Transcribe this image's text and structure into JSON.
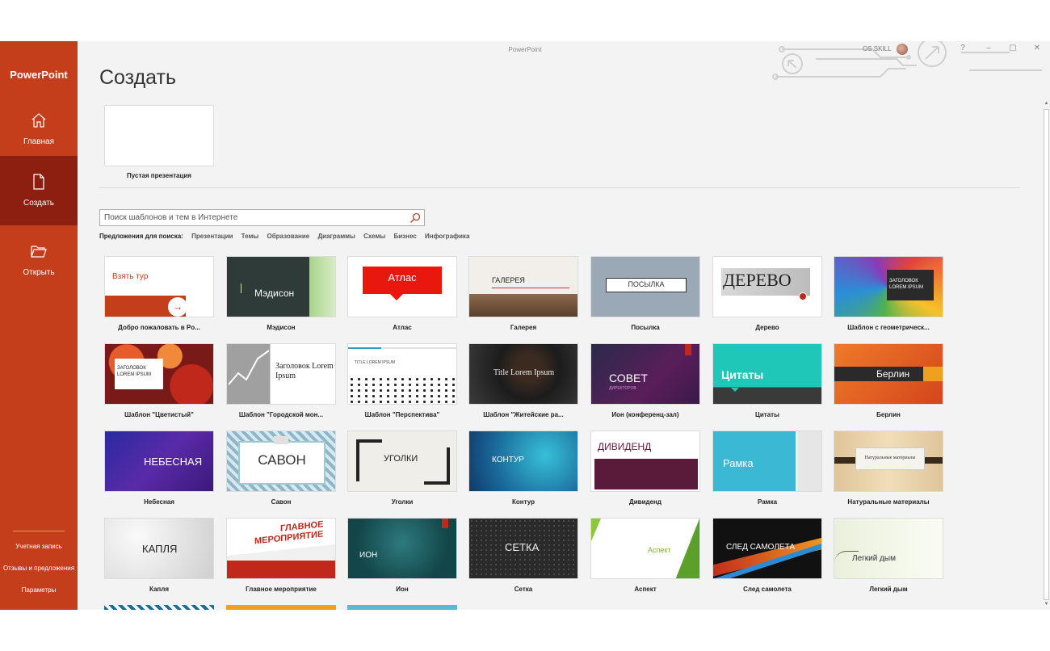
{
  "window": {
    "title": "PowerPoint",
    "user_name": "OS SKILL",
    "controls": [
      "?",
      "–",
      "▢",
      "✕"
    ]
  },
  "sidebar": {
    "app_name": "PowerPoint",
    "nav": [
      {
        "label": "Главная",
        "icon": "home-icon"
      },
      {
        "label": "Создать",
        "icon": "new-file-icon"
      },
      {
        "label": "Открыть",
        "icon": "folder-open-icon"
      }
    ],
    "bottom": [
      "Учетная запись",
      "Отзывы и предложения",
      "Параметры"
    ]
  },
  "main": {
    "title": "Создать",
    "blank_label": "Пустая презентация",
    "search": {
      "placeholder": "Поиск шаблонов и тем в Интернете"
    },
    "suggestions_label": "Предложения для поиска:",
    "suggestions": [
      "Презентации",
      "Темы",
      "Образование",
      "Диаграммы",
      "Схемы",
      "Бизнес",
      "Инфографика"
    ],
    "templates": [
      {
        "name": "Добро пожаловать в Po...",
        "thumb_text": "Взять тур"
      },
      {
        "name": "Мэдисон",
        "thumb_text": "Мэдисон"
      },
      {
        "name": "Атлас",
        "thumb_text": "Атлас"
      },
      {
        "name": "Галерея",
        "thumb_text": "ГАЛЕРЕЯ"
      },
      {
        "name": "Посылка",
        "thumb_text": "ПОСЫЛКА"
      },
      {
        "name": "Дерево",
        "thumb_text": "ДЕРЕВО"
      },
      {
        "name": "Шаблон с геометрическ...",
        "thumb_text": "ЗАГОЛОВОК LOREM IPSUM"
      },
      {
        "name": "Шаблон \"Цветистый\"",
        "thumb_text": "ЗАГОЛОВОК LOREM IPSUM"
      },
      {
        "name": "Шаблон \"Городской мон...",
        "thumb_text": "Заголовок Lorem Ipsum"
      },
      {
        "name": "Шаблон \"Перспектива\"",
        "thumb_text": "TITLE LOREM IPSUM"
      },
      {
        "name": "Шаблон \"Житейские ра...",
        "thumb_text": "Title Lorem Ipsum"
      },
      {
        "name": "Ион (конференц-зал)",
        "thumb_text": "СОВЕТ",
        "thumb_sub": "ДИРЕКТОРОВ"
      },
      {
        "name": "Цитаты",
        "thumb_text": "Цитаты"
      },
      {
        "name": "Берлин",
        "thumb_text": "Берлин"
      },
      {
        "name": "Небесная",
        "thumb_text": "НЕБЕСНАЯ"
      },
      {
        "name": "Савон",
        "thumb_text": "САВОН"
      },
      {
        "name": "Уголки",
        "thumb_text": "УГОЛКИ"
      },
      {
        "name": "Контур",
        "thumb_text": "КОНТУР"
      },
      {
        "name": "Дивиденд",
        "thumb_text": "ДИВИДЕНД"
      },
      {
        "name": "Рамка",
        "thumb_text": "Рамка"
      },
      {
        "name": "Натуральные материалы",
        "thumb_text": "Натуральные материалы"
      },
      {
        "name": "Капля",
        "thumb_text": "КАПЛЯ"
      },
      {
        "name": "Главное мероприятие",
        "thumb_text": "ГЛАВНОЕ",
        "thumb_sub": "МЕРОПРИЯТИЕ"
      },
      {
        "name": "Ион",
        "thumb_text": "ИОН"
      },
      {
        "name": "Сетка",
        "thumb_text": "СЕТКА"
      },
      {
        "name": "Аспект",
        "thumb_text": "Аспект"
      },
      {
        "name": "След самолета",
        "thumb_text": "СЛЕД САМОЛЕТА"
      },
      {
        "name": "Легкий дым",
        "thumb_text": "Легкий дым"
      }
    ]
  }
}
